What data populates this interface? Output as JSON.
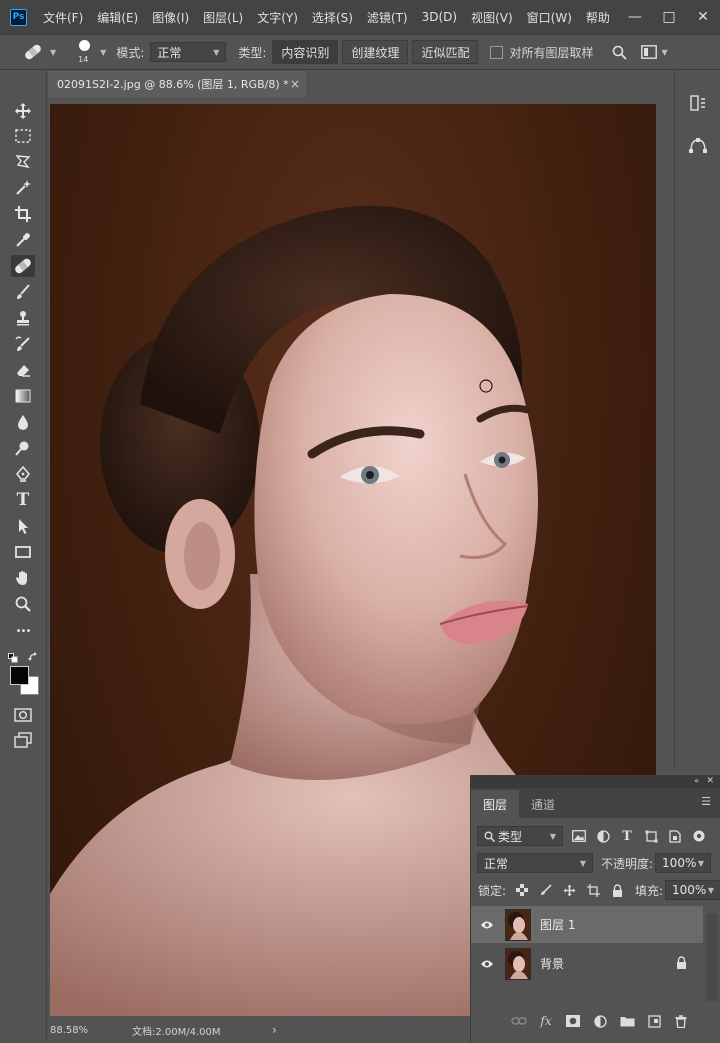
{
  "app": {
    "logo_text": "Ps",
    "menu": [
      "文件(F)",
      "编辑(E)",
      "图像(I)",
      "图层(L)",
      "文字(Y)",
      "选择(S)",
      "滤镜(T)",
      "3D(D)",
      "视图(V)",
      "窗口(W)",
      "帮助"
    ],
    "window_controls": [
      "—",
      "□",
      "✕"
    ]
  },
  "options_bar": {
    "brush_size": "14",
    "mode_label": "模式:",
    "mode_value": "正常",
    "type_label": "类型:",
    "type_options": [
      "内容识别",
      "创建纹理",
      "近似匹配"
    ],
    "type_selected": "内容识别",
    "sample_all_label": "对所有图层取样"
  },
  "document": {
    "tab_title": "02091S2I-2.jpg @ 88.6% (图层 1, RGB/8) *",
    "tab_close": "×"
  },
  "status_bar": {
    "zoom": "88.58%",
    "doc_size": "文档:2.00M/4.00M",
    "arrow": "›"
  },
  "toolbar": {
    "tools": [
      "move-tool",
      "marquee-tool",
      "lasso-tool",
      "magic-wand-tool",
      "crop-tool",
      "eyedropper-tool",
      "spot-healing-brush-tool",
      "brush-tool",
      "clone-stamp-tool",
      "history-brush-tool",
      "eraser-tool",
      "gradient-tool",
      "blur-tool",
      "dodge-tool",
      "pen-tool",
      "type-tool",
      "path-selection-tool",
      "rectangle-tool",
      "hand-tool",
      "zoom-tool",
      "more-tools"
    ],
    "active_tool": "spot-healing-brush-tool",
    "type_tool_glyph": "T",
    "more_glyph": "•••",
    "foreground_color": "#050505",
    "background_color": "#ffffff"
  },
  "layers_panel": {
    "tabs": [
      "图层",
      "通道"
    ],
    "active_tab": "图层",
    "filter_kind": "类型",
    "blend_mode": "正常",
    "opacity_label": "不透明度:",
    "opacity_value": "100%",
    "lock_label": "锁定:",
    "fill_label": "填充:",
    "fill_value": "100%",
    "layers": [
      {
        "name": "图层 1",
        "selected": true,
        "locked": false,
        "visible": true
      },
      {
        "name": "背景",
        "selected": false,
        "locked": true,
        "visible": true
      }
    ],
    "footer_fx": "fx"
  },
  "colors": {
    "accent": "#31a8ff",
    "panel_bg": "#535353",
    "menubar_bg": "#444444",
    "selected_layer": "#6a6a6a"
  }
}
